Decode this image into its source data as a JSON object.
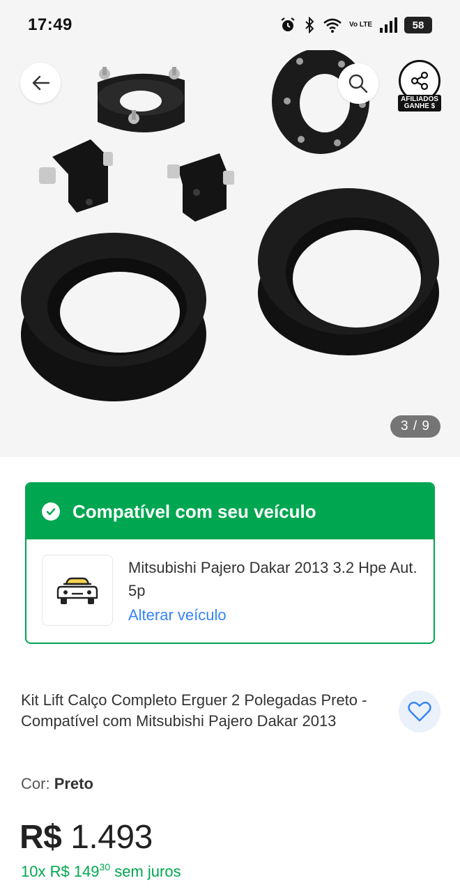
{
  "status_bar": {
    "time": "17:49",
    "battery": "58",
    "network": "Vo LTE",
    "icons": [
      "alarm-icon",
      "bluetooth-icon",
      "wifi-icon",
      "volte-icon",
      "signal-icon",
      "battery-icon"
    ]
  },
  "gallery": {
    "counter": "3 / 9",
    "affiliate_label_line1": "AFILIADOS",
    "affiliate_label_line2": "GANHE $",
    "icons": [
      "back-arrow-icon",
      "search-icon",
      "share-icon"
    ]
  },
  "compat": {
    "title": "Compatível com seu veículo",
    "vehicle": "Mitsubishi Pajero Dakar 2013 3.2 Hpe Aut. 5p",
    "change_link": "Alterar veículo",
    "icons": [
      "check-icon",
      "car-icon"
    ]
  },
  "product": {
    "title": "Kit Lift Calço Completo Erguer 2 Polegadas Preto - Compatível com Mitsubishi Pajero Dakar 2013",
    "color_label": "Cor:",
    "color_value": "Preto",
    "price_currency": "R$",
    "price_value": "1.493",
    "installments_prefix": "10x R$ 149",
    "installments_cents": "30",
    "installments_suffix": "sem juros",
    "icons": [
      "heart-icon"
    ]
  },
  "colors": {
    "green": "#00a650",
    "blue": "#3483fa",
    "gallery_bg": "#f5f5f5",
    "counter_bg": "#757575"
  }
}
